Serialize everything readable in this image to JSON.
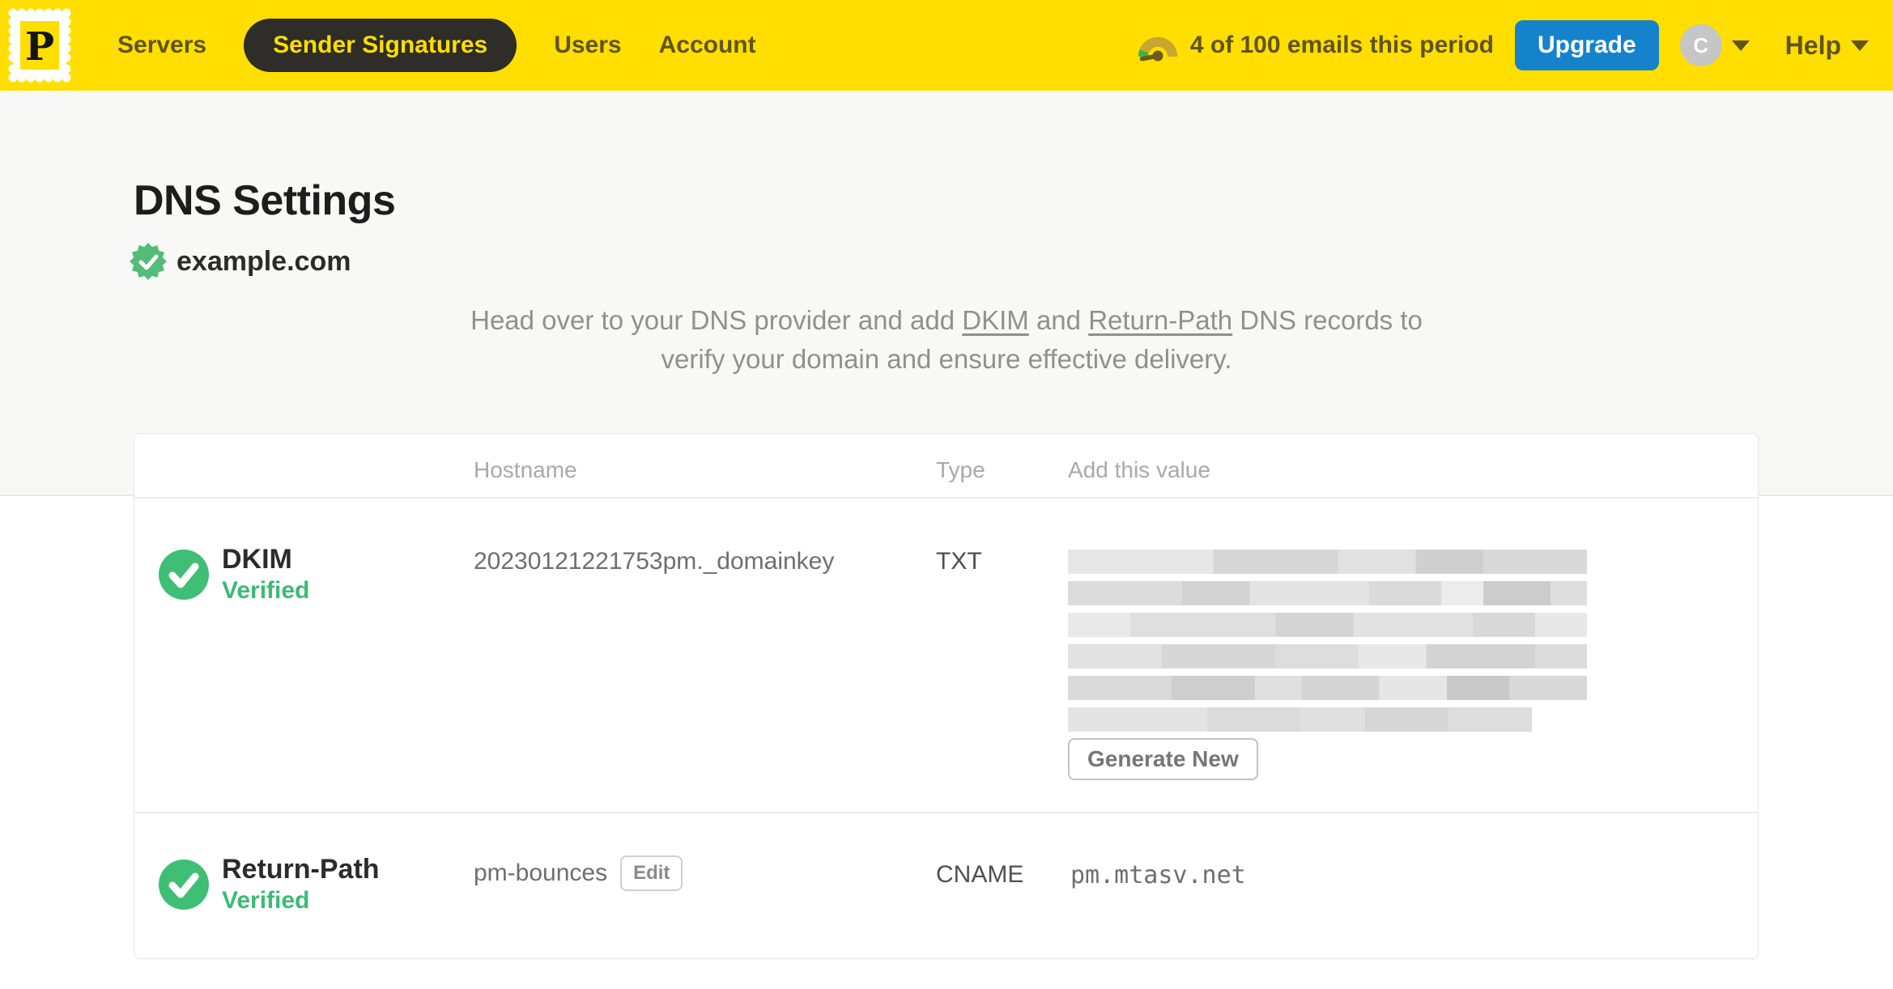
{
  "nav": {
    "logo_letter": "P",
    "items": [
      {
        "label": "Servers",
        "active": false
      },
      {
        "label": "Sender Signatures",
        "active": true
      },
      {
        "label": "Users",
        "active": false
      },
      {
        "label": "Account",
        "active": false
      }
    ],
    "usage_text": "4 of 100 emails this period",
    "upgrade_label": "Upgrade",
    "avatar_initial": "C",
    "help_label": "Help"
  },
  "page": {
    "title": "DNS Settings",
    "domain": "example.com",
    "description": {
      "pre": "Head over to your DNS provider and add ",
      "dkim": "DKIM",
      "and": " and ",
      "return_path": "Return-Path",
      "post": " DNS records to verify your domain and ensure effective delivery."
    }
  },
  "table": {
    "headers": {
      "hostname": "Hostname",
      "type": "Type",
      "value": "Add this value"
    },
    "rows": [
      {
        "name": "DKIM",
        "status": "Verified",
        "hostname": "20230121221753pm._domainkey",
        "type": "TXT",
        "value_redacted": true,
        "redacted_lines": 6,
        "action": "Generate New"
      },
      {
        "name": "Return-Path",
        "status": "Verified",
        "hostname": "pm-bounces",
        "edit_label": "Edit",
        "type": "CNAME",
        "value": "pm.mtasv.net"
      }
    ]
  },
  "colors": {
    "brand_yellow": "#FFDE00",
    "nav_text": "#5f5418",
    "active_pill_bg": "#2e2d27",
    "upgrade_blue": "#1583CC",
    "verified_green": "#3cba74",
    "page_band_gray": "#f8f8f6"
  }
}
